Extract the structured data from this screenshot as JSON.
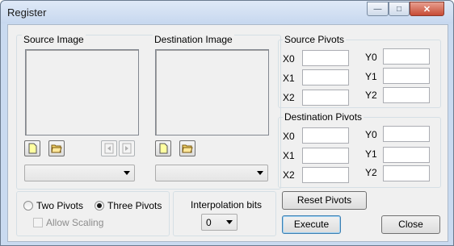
{
  "window": {
    "title": "Register"
  },
  "titlebar_buttons": {
    "minimize": "—",
    "maximize": "□",
    "close": "✕"
  },
  "source_image": {
    "label": "Source Image",
    "dropdown_value": ""
  },
  "destination_image": {
    "label": "Destination Image",
    "dropdown_value": ""
  },
  "source_pivots": {
    "label": "Source Pivots",
    "fields": [
      {
        "label": "X0",
        "value": ""
      },
      {
        "label": "Y0",
        "value": ""
      },
      {
        "label": "X1",
        "value": ""
      },
      {
        "label": "Y1",
        "value": ""
      },
      {
        "label": "X2",
        "value": ""
      },
      {
        "label": "Y2",
        "value": ""
      }
    ]
  },
  "destination_pivots": {
    "label": "Destination Pivots",
    "fields": [
      {
        "label": "X0",
        "value": ""
      },
      {
        "label": "Y0",
        "value": ""
      },
      {
        "label": "X1",
        "value": ""
      },
      {
        "label": "Y1",
        "value": ""
      },
      {
        "label": "X2",
        "value": ""
      },
      {
        "label": "Y2",
        "value": ""
      }
    ]
  },
  "pivot_mode": {
    "two": "Two Pivots",
    "three": "Three Pivots",
    "selected": "three",
    "allow_scaling": "Allow Scaling",
    "allow_scaling_enabled": false
  },
  "interpolation": {
    "label": "Interpolation bits",
    "value": "0"
  },
  "buttons": {
    "reset_pivots": "Reset Pivots",
    "execute": "Execute",
    "close": "Close"
  },
  "icons": {
    "new": "new-file-icon",
    "open": "open-folder-icon",
    "prev": "prev-icon",
    "next": "next-icon"
  }
}
